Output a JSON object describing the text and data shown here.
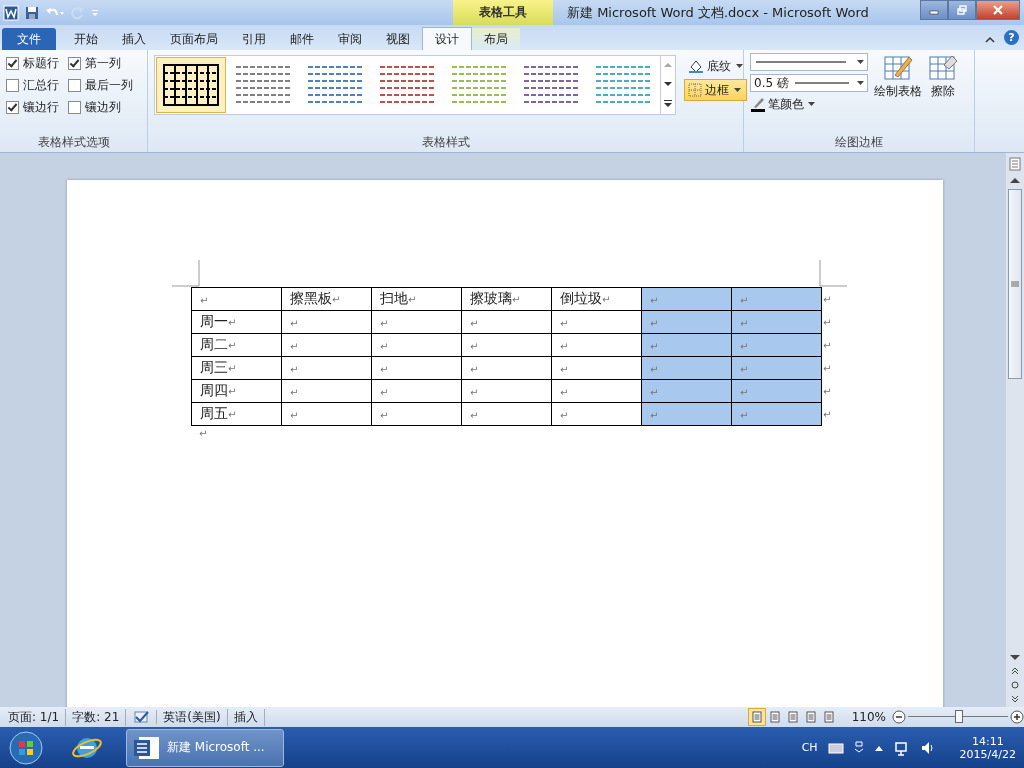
{
  "window": {
    "title": "新建 Microsoft Word 文档.docx - Microsoft Word",
    "context_tab_group": "表格工具"
  },
  "help_button": "?",
  "tabs": [
    {
      "label": "文件",
      "kind": "file",
      "selected": false
    },
    {
      "label": "开始",
      "kind": "tab",
      "selected": false
    },
    {
      "label": "插入",
      "kind": "tab",
      "selected": false
    },
    {
      "label": "页面布局",
      "kind": "tab",
      "selected": false
    },
    {
      "label": "引用",
      "kind": "tab",
      "selected": false
    },
    {
      "label": "邮件",
      "kind": "tab",
      "selected": false
    },
    {
      "label": "审阅",
      "kind": "tab",
      "selected": false
    },
    {
      "label": "视图",
      "kind": "tab",
      "selected": false
    },
    {
      "label": "设计",
      "kind": "context",
      "selected": true
    },
    {
      "label": "布局",
      "kind": "context",
      "selected": false
    }
  ],
  "ribbon": {
    "style_options": {
      "label": "表格样式选项",
      "options": [
        {
          "label": "标题行",
          "checked": true
        },
        {
          "label": "第一列",
          "checked": true
        },
        {
          "label": "汇总行",
          "checked": false
        },
        {
          "label": "最后一列",
          "checked": false
        },
        {
          "label": "镶边行",
          "checked": true
        },
        {
          "label": "镶边列",
          "checked": false
        }
      ]
    },
    "table_styles": {
      "label": "表格样式",
      "styles": [
        {
          "color": "#000000",
          "selected": true
        },
        {
          "color": "#808080",
          "selected": false
        },
        {
          "color": "#4f81bd",
          "selected": false
        },
        {
          "color": "#c0504d",
          "selected": false
        },
        {
          "color": "#9bbb59",
          "selected": false
        },
        {
          "color": "#8064a2",
          "selected": false
        },
        {
          "color": "#4bacc6",
          "selected": false
        }
      ],
      "shading": {
        "label": "底纹",
        "active": false
      },
      "borders": {
        "label": "边框",
        "active": true
      }
    },
    "draw_borders": {
      "label": "绘图边框",
      "line_weight": "0.5 磅",
      "pen_color": "笔颜色",
      "draw_table": "绘制表格",
      "eraser": "擦除"
    }
  },
  "document": {
    "columns": [
      {
        "selected": false
      },
      {
        "selected": false
      },
      {
        "selected": false
      },
      {
        "selected": false
      },
      {
        "selected": false
      },
      {
        "selected": true
      },
      {
        "selected": true
      }
    ],
    "rows": [
      {
        "cells": [
          "↵",
          "擦黑板↵",
          "扫地↵",
          "擦玻璃↵",
          "倒垃圾↵",
          "↵",
          "↵"
        ],
        "end_mark": "↵"
      },
      {
        "cells": [
          "周一↵",
          "↵",
          "↵",
          "↵",
          "↵",
          "↵",
          "↵"
        ],
        "end_mark": "↵"
      },
      {
        "cells": [
          "周二↵",
          "↵",
          "↵",
          "↵",
          "↵",
          "↵",
          "↵"
        ],
        "end_mark": "↵"
      },
      {
        "cells": [
          "周三↵",
          "↵",
          "↵",
          "↵",
          "↵",
          "↵",
          "↵"
        ],
        "end_mark": "↵"
      },
      {
        "cells": [
          "周四↵",
          "↵",
          "↵",
          "↵",
          "↵",
          "↵",
          "↵"
        ],
        "end_mark": "↵"
      },
      {
        "cells": [
          "周五↵",
          "↵",
          "↵",
          "↵",
          "↵",
          "↵",
          "↵"
        ],
        "end_mark": "↵"
      }
    ],
    "after_table": "↵"
  },
  "status_bar": {
    "page": "页面: 1/1",
    "words": "字数: 21",
    "language": "英语(美国)",
    "mode": "插入",
    "views": [
      {
        "selected": true
      },
      {
        "selected": false
      },
      {
        "selected": false
      },
      {
        "selected": false
      },
      {
        "selected": false
      }
    ],
    "zoom": "110%",
    "zoom_slider": {
      "level": 0.51
    }
  },
  "taskbar": {
    "task": "新建 Microsoft ...",
    "input_method": "CH",
    "time": "14:11",
    "date": "2015/4/22"
  }
}
